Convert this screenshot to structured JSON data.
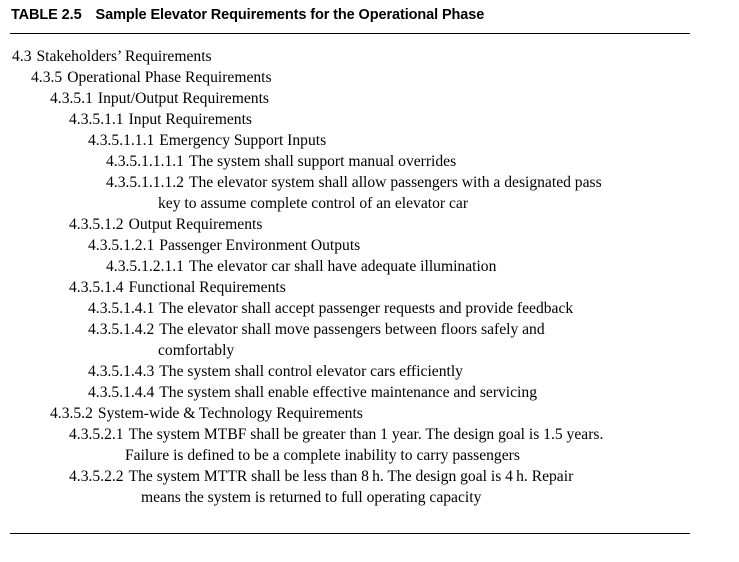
{
  "caption": {
    "label": "TABLE 2.5",
    "title": "Sample Elevator Requirements for the Operational Phase"
  },
  "rules": {
    "color": "#000000"
  },
  "requirements": [
    {
      "number": "4.3",
      "text": "Stakeholders’ Requirements",
      "level": 1
    },
    {
      "number": "4.3.5",
      "text": "Operational Phase Requirements",
      "level": 2
    },
    {
      "number": "4.3.5.1",
      "text": "Input/Output Requirements",
      "level": 3
    },
    {
      "number": "4.3.5.1.1",
      "text": "Input Requirements",
      "level": 4
    },
    {
      "number": "4.3.5.1.1.1",
      "text": "Emergency Support Inputs",
      "level": 5
    },
    {
      "number": "4.3.5.1.1.1.1",
      "text": "The system shall support manual overrides",
      "level": 6
    },
    {
      "number": "4.3.5.1.1.1.2",
      "text": "The elevator system shall allow passengers with a designated pass",
      "level": 6,
      "continuation": "key to assume complete control of an elevator car",
      "cont_style": "cont-a"
    },
    {
      "number": "4.3.5.1.2",
      "text": "Output Requirements",
      "level": 4
    },
    {
      "number": "4.3.5.1.2.1",
      "text": "Passenger Environment Outputs",
      "level": 5
    },
    {
      "number": "4.3.5.1.2.1.1",
      "text": "The elevator car shall have adequate illumination",
      "level": 6
    },
    {
      "number": "4.3.5.1.4",
      "text": "Functional Requirements",
      "level": 4
    },
    {
      "number": "4.3.5.1.4.1",
      "text": "The elevator shall accept passenger requests and provide feedback",
      "level": 5
    },
    {
      "number": "4.3.5.1.4.2",
      "text": "The elevator shall move passengers between floors safely and",
      "level": 5,
      "continuation": "comfortably",
      "cont_style": "cont-a"
    },
    {
      "number": "4.3.5.1.4.3",
      "text": "The system shall control elevator cars efficiently",
      "level": 5
    },
    {
      "number": "4.3.5.1.4.4",
      "text": "The system shall enable effective maintenance and servicing",
      "level": 5
    },
    {
      "number": "4.3.5.2",
      "text": "System-wide & Technology Requirements",
      "level": 3
    },
    {
      "number": "4.3.5.2.1",
      "text": "The system MTBF shall be greater than 1 year. The design goal is 1.5 years.",
      "level": 4,
      "continuation": "Failure is defined to be a complete inability to carry passengers",
      "cont_style": "cont-b"
    },
    {
      "number": "4.3.5.2.2",
      "text": "The system MTTR shall be less than 8 h. The design goal is 4 h. Repair",
      "level": 4,
      "continuation": "means the system is returned to full operating capacity",
      "cont_style": "cont-c"
    }
  ]
}
